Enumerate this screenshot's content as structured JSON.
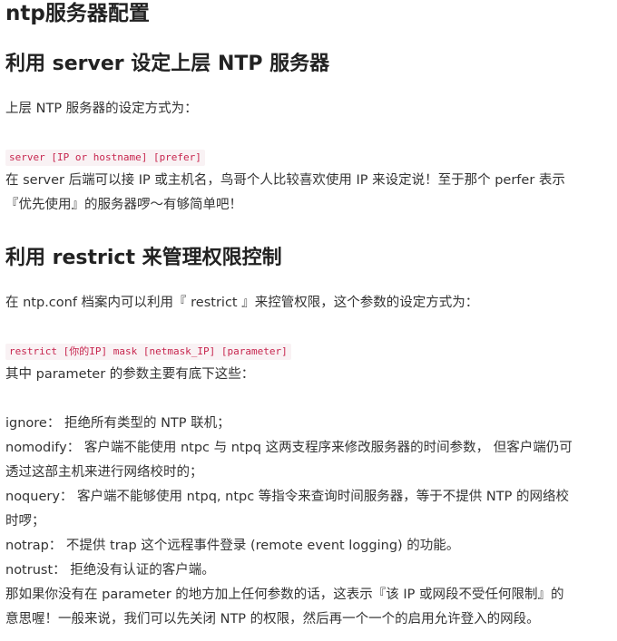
{
  "title": "ntp服务器配置",
  "section1": {
    "heading": "利用 server 设定上层 NTP 服务器",
    "intro": "上层 NTP 服务器的设定方式为：",
    "code": "server [IP or hostname] [prefer]",
    "desc_line1": "在 server 后端可以接 IP 或主机名，鸟哥个人比较喜欢使用 IP 来设定说！至于那个 perfer 表示",
    "desc_line2": "『优先使用』的服务器啰～有够简单吧！"
  },
  "section2": {
    "heading": "利用 restrict 来管理权限控制",
    "intro": "在 ntp.conf 档案内可以利用『 restrict 』来控管权限，这个参数的设定方式为：",
    "code": "restrict [你的IP] mask [netmask_IP] [parameter]",
    "params_intro": "其中 parameter 的参数主要有底下这些：",
    "ignore": "ignore： 拒绝所有类型的 NTP 联机；",
    "nomodify_line1": "nomodify： 客户端不能使用 ntpc 与 ntpq 这两支程序来修改服务器的时间参数， 但客户端仍可",
    "nomodify_line2": "透过这部主机来进行网络校时的；",
    "noquery_line1": "noquery： 客户端不能够使用 ntpq, ntpc 等指令来查询时间服务器，等于不提供 NTP 的网络校",
    "noquery_line2": "时啰；",
    "notrap": "notrap： 不提供 trap 这个远程事件登录 (remote event logging) 的功能。",
    "notrust": "notrust： 拒绝没有认证的客户端。",
    "closing_line1": "那如果你没有在 parameter 的地方加上任何参数的话，这表示『该 IP 或网段不受任何限制』的",
    "closing_line2": "意思喔！一般来说，我们可以先关闭 NTP 的权限，然后再一个一个的启用允许登入的网段。"
  }
}
